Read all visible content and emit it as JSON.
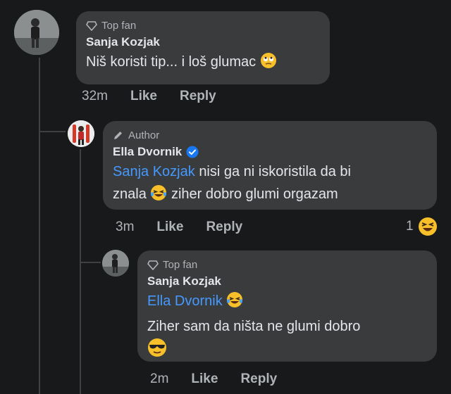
{
  "comments": [
    {
      "badge": "Top fan",
      "name": "Sanja Kozjak",
      "text": "Niš koristi tip... i loš glumac",
      "emoji": "rolling-eyes-emoji",
      "time": "32m",
      "like": "Like",
      "reply": "Reply"
    },
    {
      "badge": "Author",
      "name": "Ella Dvornik",
      "verified": true,
      "mention": "Sanja Kozjak",
      "text_line1": "nisi ga ni iskoristila da bi",
      "text_line2_a": "znala",
      "text_line2_b": "ziher dobro glumi orgazam",
      "emoji": "laughing-tears-emoji",
      "time": "3m",
      "like": "Like",
      "reply": "Reply",
      "reaction_count": "1",
      "reaction_emoji": "squinting-laughing-emoji"
    },
    {
      "badge": "Top fan",
      "name": "Sanja Kozjak",
      "mention": "Ella Dvornik",
      "mention_emoji": "laughing-tears-emoji",
      "text": "Ziher sam da ništa ne glumi dobro",
      "emoji": "sunglasses-emoji",
      "time": "2m",
      "like": "Like",
      "reply": "Reply"
    }
  ],
  "colors": {
    "background": "#18191a",
    "bubble": "#3a3b3c",
    "mention": "#4599ff",
    "verified": "#1877f2",
    "muted": "#b0b3b8"
  }
}
